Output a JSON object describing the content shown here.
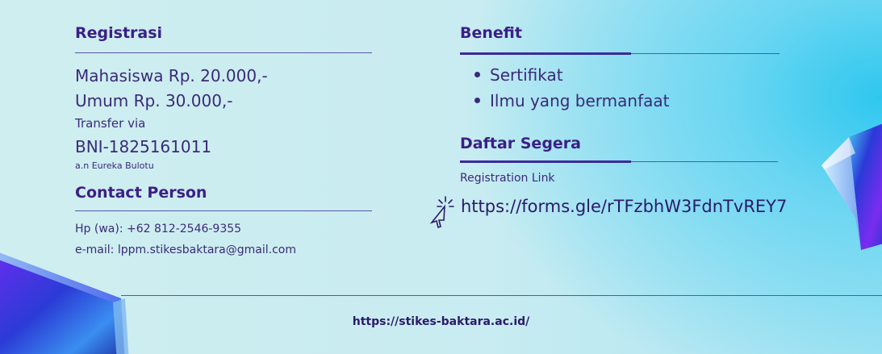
{
  "registrasi": {
    "heading": "Registrasi",
    "mahasiswa": "Mahasiswa Rp. 20.000,-",
    "umum": "Umum Rp. 30.000,-",
    "transfer_via": "Transfer via",
    "account": "BNI-1825161011",
    "account_name": "a.n Eureka Bulotu"
  },
  "contact": {
    "heading": "Contact Person",
    "phone": "Hp (wa): +62 812-2546-9355",
    "email": "e-mail: lppm.stikesbaktara@gmail.com"
  },
  "benefit": {
    "heading": "Benefit",
    "items": [
      "Sertifikat",
      "Ilmu yang bermanfaat"
    ]
  },
  "daftar": {
    "heading": "Daftar Segera",
    "link_label": "Registration Link",
    "link_url": "https://forms.gle/rTFzbhW3FdnTvREY7",
    "cursor_icon": "pointer-click-icon"
  },
  "footer": {
    "url": "https://stikes-baktara.ac.id/"
  },
  "colors": {
    "heading": "#3b1f86",
    "text": "#3a2a78",
    "accent_cyan": "#2fc7ef"
  }
}
